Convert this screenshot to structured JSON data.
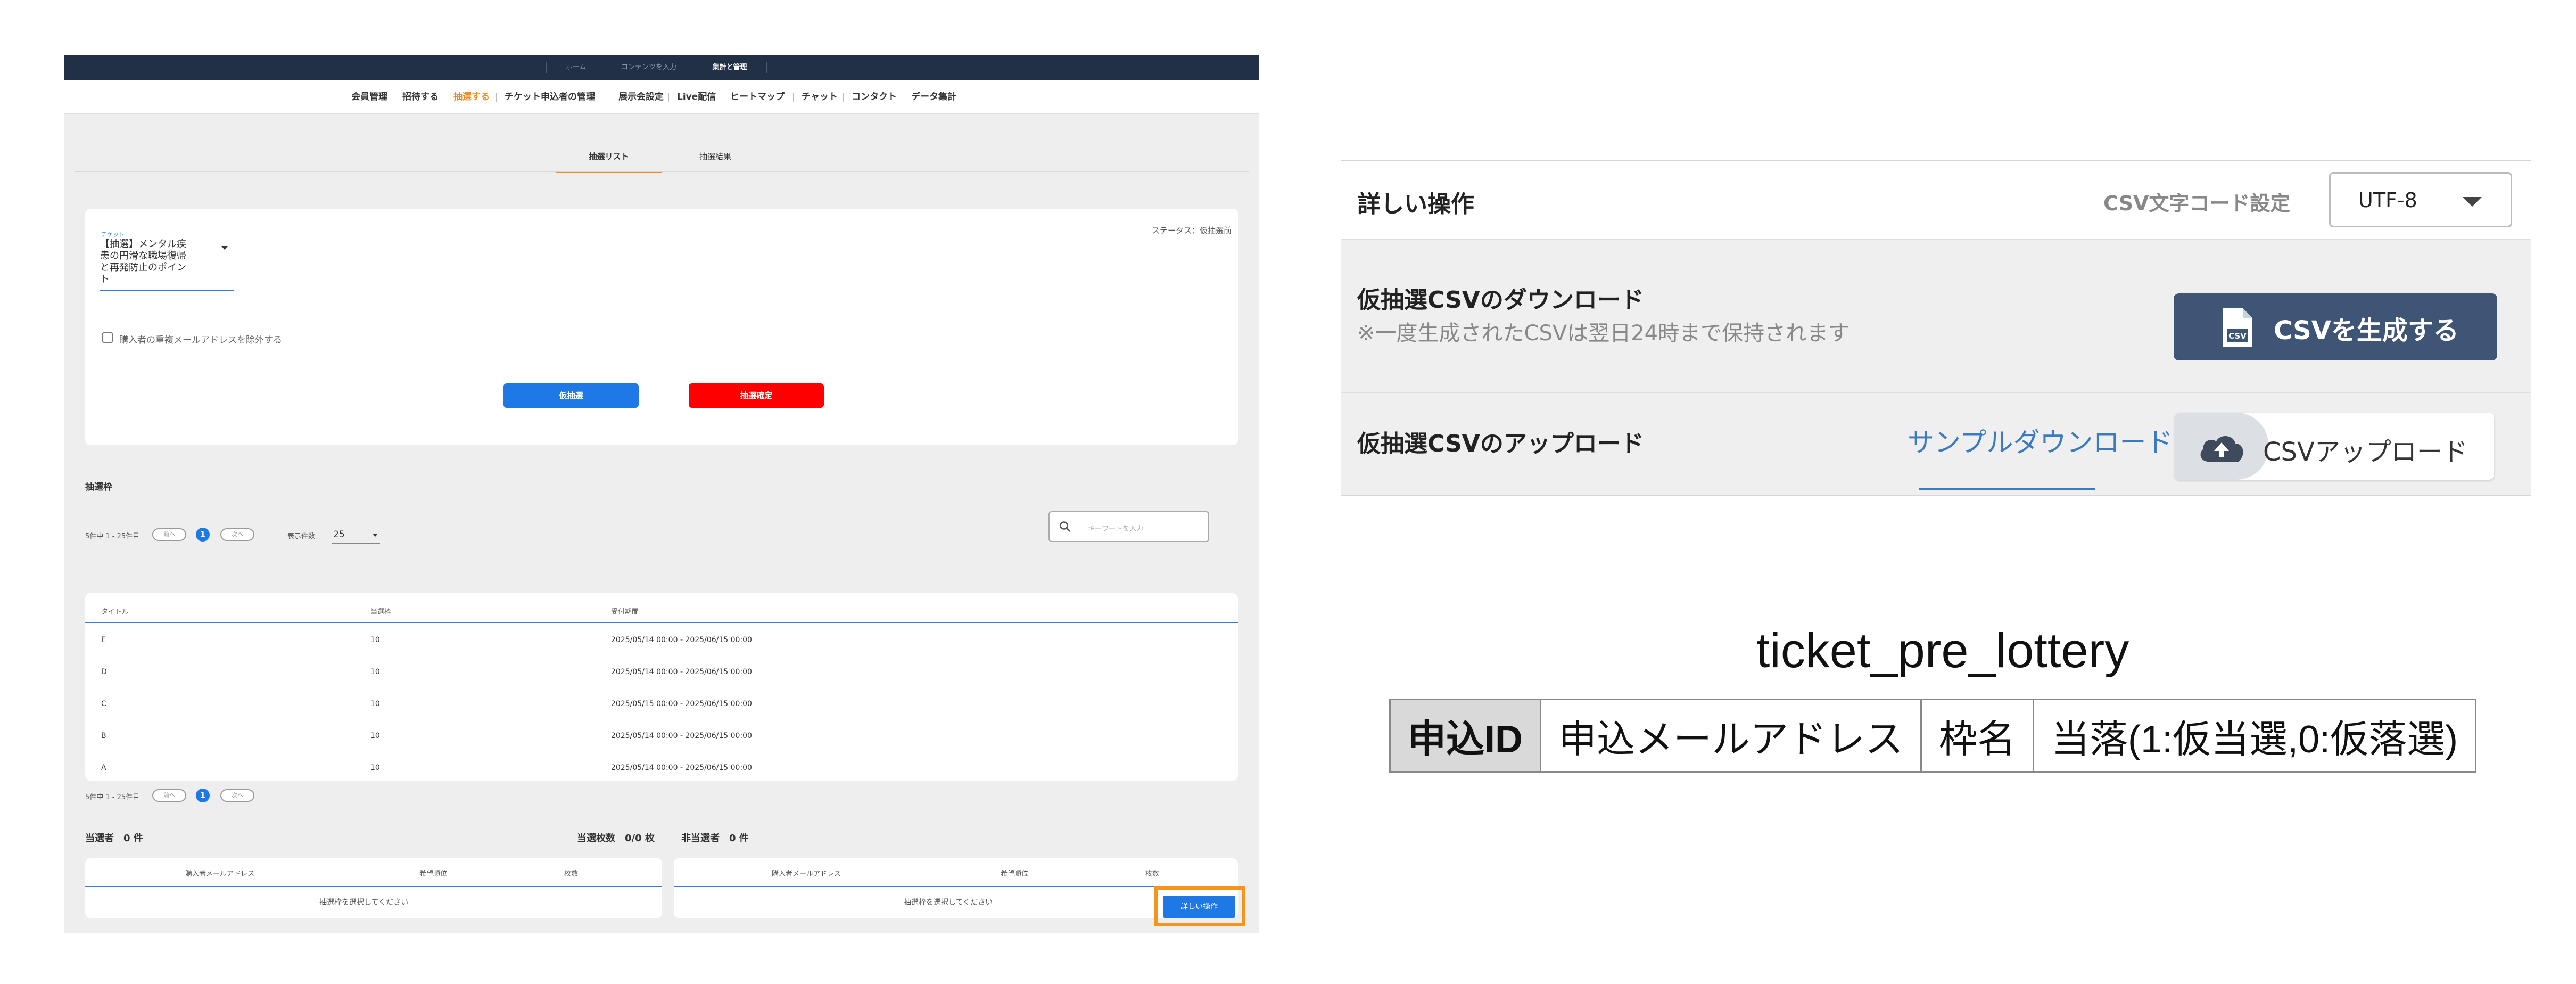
{
  "topnav": [
    "ホーム",
    "コンテンツを入力",
    "集計と管理"
  ],
  "mainnav": [
    "会員管理",
    "招待する",
    "抽選する",
    "チケット申込者の管理",
    "展示会設定",
    "Live配信",
    "ヒートマップ",
    "チャット",
    "コンタクト",
    "データ集計"
  ],
  "tabs": [
    "抽選リスト",
    "抽選結果"
  ],
  "filter": {
    "ticket_label": "チケット",
    "ticket_lines": [
      "【抽選】メンタル疾",
      "患の円滑な職場復帰",
      "と再発防止のポイン",
      "ト"
    ],
    "status": "ステータス：仮抽選前",
    "exclude_checkbox_label": "購入者の重複メールアドレスを除外する",
    "pre_lottery_button": "仮抽選",
    "confirm_button": "抽選確定"
  },
  "slots": {
    "title": "抽選枠",
    "pager_text": "5件中 1 - 25件目",
    "prev": "前へ",
    "next": "次へ",
    "page": "1",
    "per_page_label": "表示件数",
    "per_page_value": "25",
    "search_placeholder": "キーワードを入力",
    "columns": [
      "タイトル",
      "当選枠",
      "受付期間"
    ],
    "rows": [
      {
        "title": "E",
        "quota": "10",
        "period": "2025/05/14 00:00 - 2025/06/15 00:00"
      },
      {
        "title": "D",
        "quota": "10",
        "period": "2025/05/14 00:00 - 2025/06/15 00:00"
      },
      {
        "title": "C",
        "quota": "10",
        "period": "2025/05/15 00:00 - 2025/06/15 00:00"
      },
      {
        "title": "B",
        "quota": "10",
        "period": "2025/05/14 00:00 - 2025/06/15 00:00"
      },
      {
        "title": "A",
        "quota": "10",
        "period": "2025/05/14 00:00 - 2025/06/15 00:00"
      }
    ]
  },
  "results": {
    "winners": "当選者　0 件",
    "tickets": "当選枚数　0/0 枚",
    "non_winners": "非当選者　0 件",
    "columns": [
      "購入者メールアドレス",
      "希望順位",
      "枚数"
    ],
    "empty_text": "抽選枠を選択してください",
    "detail_button": "詳しい操作"
  },
  "detail_panel": {
    "title": "詳しい操作",
    "csv_encoding_label": "CSV文字コード設定",
    "encoding_value": "UTF-8",
    "download_title": "仮抽選CSVのダウンロード",
    "download_note": "※一度生成されたCSVは翌日24時まで保持されます",
    "generate_button": "CSVを生成する",
    "upload_title": "仮抽選CSVのアップロード",
    "sample_link": "サンプルダウンロード",
    "upload_button": "CSVアップロード",
    "csv_icon_text": "CSV"
  },
  "db_table": {
    "name": "ticket_pre_lottery",
    "columns": [
      "申込ID",
      "申込メールアドレス",
      "枠名",
      "当落(1:仮当選,0:仮落選)"
    ]
  },
  "colors": {
    "navy": "#223046",
    "accent_orange": "#f08a24",
    "primary_blue": "#1e78e6",
    "danger_red": "#ff0000",
    "highlight_orange": "#f7941d",
    "csv_button": "#3f5575"
  }
}
